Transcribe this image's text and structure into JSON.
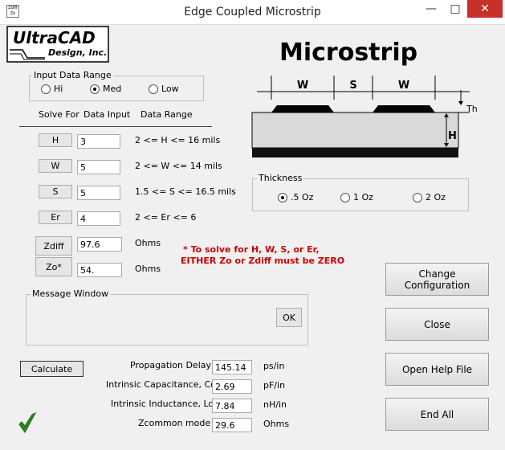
{
  "window": {
    "title": "Edge Coupled Microstrip",
    "icon_text_top": "ZdIff",
    "icon_text_bottom": "Zo",
    "minimize": "—",
    "maximize": "□",
    "close": "✕"
  },
  "logo": {
    "line1": "UltraCAD",
    "line2": "Design, Inc."
  },
  "diagram": {
    "heading": "Microstrip",
    "w1": "W",
    "s": "S",
    "w2": "W",
    "th": "Th",
    "h": "H"
  },
  "input_range": {
    "legend": "Input Data Range",
    "options": [
      {
        "label": "Hi",
        "selected": false
      },
      {
        "label": "Med",
        "selected": true
      },
      {
        "label": "Low",
        "selected": false
      }
    ]
  },
  "table": {
    "headers": {
      "solve_for": "Solve For",
      "data_input": "Data Input",
      "data_range": "Data Range"
    },
    "rows": [
      {
        "button": "H",
        "value": "3",
        "range": "2 <= H <= 16 mils"
      },
      {
        "button": "W",
        "value": "5",
        "range": "2 <= W <= 14 mils"
      },
      {
        "button": "S",
        "value": "5",
        "range": "1.5 <= S <= 16.5 mils"
      },
      {
        "button": "Er",
        "value": "4",
        "range": "2 <= Er <= 6"
      }
    ],
    "zdiff": {
      "button": "Zdiff",
      "value": "97.6",
      "unit": "Ohms"
    },
    "zo": {
      "button": "Zo*",
      "value": "54.",
      "unit": "Ohms"
    }
  },
  "note": {
    "line1": "* To solve for H, W, S, or Er,",
    "line2": "EITHER Zo or Zdiff must be ZERO"
  },
  "thickness": {
    "legend": "Thickness",
    "options": [
      {
        "label": ".5 Oz",
        "selected": true
      },
      {
        "label": "1 Oz",
        "selected": false
      },
      {
        "label": "2 Oz",
        "selected": false
      }
    ]
  },
  "message": {
    "legend": "Message Window",
    "ok": "OK"
  },
  "calculate": "Calculate",
  "results": [
    {
      "label": "Propagation Delay",
      "value": "145.14",
      "unit": "ps/in"
    },
    {
      "label": "Intrinsic Capacitance, Co",
      "value": "2.69",
      "unit": "pF/in"
    },
    {
      "label": "Intrinsic Inductance, Lo",
      "value": "7.84",
      "unit": "nH/in"
    },
    {
      "label": "Zcommon mode",
      "value": "29.6",
      "unit": "Ohms"
    }
  ],
  "side_buttons": {
    "change_config": "Change Configuration",
    "close": "Close",
    "help": "Open Help File",
    "end_all": "End All"
  },
  "colors": {
    "note_red": "#d00000",
    "check_green": "#2a8a1e",
    "close_red": "#c7312a"
  }
}
